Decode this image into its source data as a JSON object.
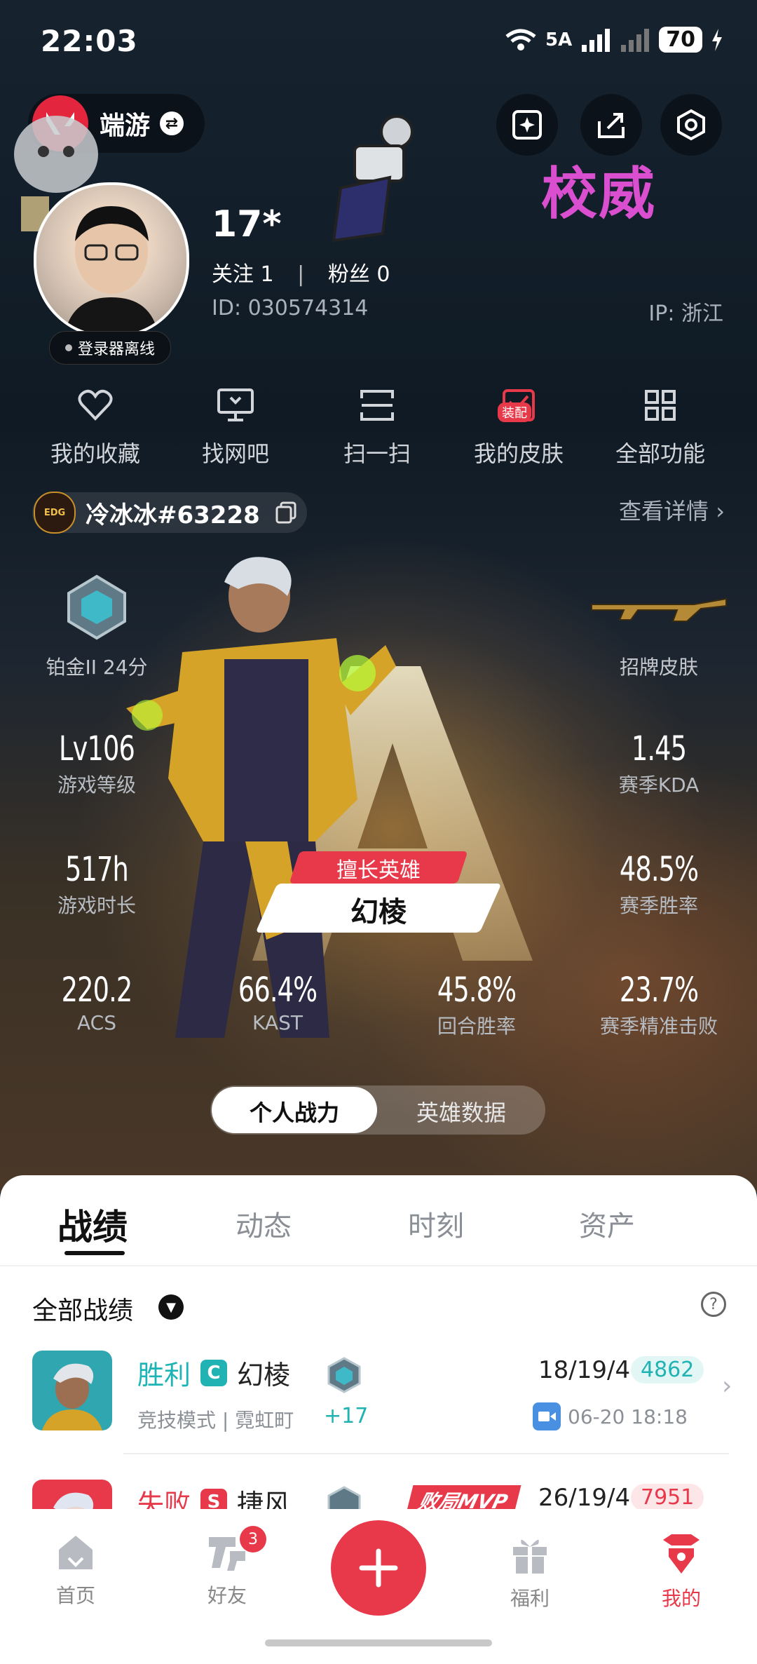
{
  "status": {
    "time": "22:03",
    "network": "5A",
    "battery": "70"
  },
  "header": {
    "game_label": "端游",
    "corner_art_text": "校威"
  },
  "profile": {
    "name": "17*",
    "follow_text": "关注 1",
    "separator": "|",
    "fans_text": "粉丝 0",
    "id_text": "ID:  030574314",
    "ip_text": "IP:  浙江",
    "offline_text": "登录器离线"
  },
  "quick_actions": [
    {
      "label": "我的收藏",
      "icon": "heart-icon"
    },
    {
      "label": "找网吧",
      "icon": "monitor-icon"
    },
    {
      "label": "扫一扫",
      "icon": "scan-icon"
    },
    {
      "label": "我的皮肤",
      "icon": "skin-icon",
      "badge": "装配"
    },
    {
      "label": "全部功能",
      "icon": "grid-icon"
    }
  ],
  "account": {
    "tag": "冷冰冰#63228",
    "team_badge": "EDG",
    "detail_label": "查看详情"
  },
  "rank": {
    "label": "铂金II 24分"
  },
  "skin": {
    "label": "招牌皮肤"
  },
  "stats": {
    "level": {
      "value": "Lv106",
      "label": "游戏等级"
    },
    "kda": {
      "value": "1.45",
      "label": "赛季KDA"
    },
    "hours": {
      "value": "517h",
      "label": "游戏时长"
    },
    "winrate": {
      "value": "48.5%",
      "label": "赛季胜率"
    },
    "acs": {
      "value": "220.2",
      "label": "ACS"
    },
    "kast": {
      "value": "66.4%",
      "label": "KAST"
    },
    "round_win": {
      "value": "45.8%",
      "label": "回合胜率"
    },
    "first_kill": {
      "value": "23.7%",
      "label": "赛季精准击败"
    }
  },
  "hero": {
    "tag": "擅长英雄",
    "name": "幻棱"
  },
  "segment": {
    "option1": "个人战力",
    "option2": "英雄数据",
    "active": "个人战力"
  },
  "tabs": [
    "战绩",
    "动态",
    "时刻",
    "资产"
  ],
  "active_tab": "战绩",
  "records": {
    "title": "全部战绩",
    "rows": [
      {
        "result": "胜利",
        "mode_badge": "C",
        "hero": "幻棱",
        "mode": "竞技模式 | 霓虹町",
        "rank_change": "+17",
        "kda": "18/19/4",
        "score": "4862",
        "time": "06-20 18:18"
      },
      {
        "result": "失败",
        "mode_badge": "S",
        "hero": "捷风",
        "mvp": "败局MVP",
        "kda": "26/19/4",
        "score": "7951"
      }
    ]
  },
  "nav": {
    "items": [
      {
        "label": "首页",
        "icon": "home-icon"
      },
      {
        "label": "好友",
        "icon": "friends-icon",
        "badge": "3"
      },
      {
        "label": "福利",
        "icon": "gift-icon"
      },
      {
        "label": "我的",
        "icon": "profile-icon"
      }
    ],
    "active": "我的"
  },
  "colors": {
    "accent": "#e8394a",
    "win": "#1cb4b4",
    "loss": "#e8394a"
  }
}
